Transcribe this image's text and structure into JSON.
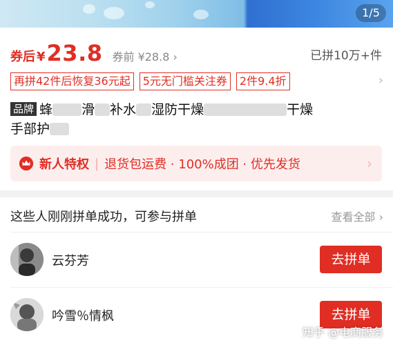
{
  "banner": {
    "pager": "1/5"
  },
  "price": {
    "label": "券后",
    "yen": "¥",
    "value": "23.8",
    "original": "券前 ¥28.8",
    "chevron": "›",
    "sold": "已拼10万+件"
  },
  "tags": [
    "再拼42件后恢复36元起",
    "5元无门槛关注券",
    "2件9.4折"
  ],
  "title": {
    "badge": "品牌",
    "part1": "蜂",
    "part2": "滑",
    "part3": "补水",
    "part4": "湿防干燥",
    "part5": "干燥",
    "line2": "手部护"
  },
  "promo": {
    "title": "新人特权",
    "separator": "|",
    "text": "退货包运费 · 100%成团 · 优先发货",
    "icon": "crown-icon"
  },
  "group": {
    "heading": "这些人刚刚拼单成功，可参与拼单",
    "view_all": "查看全部",
    "users": [
      {
        "name": "云芬芳",
        "button": "去拼单"
      },
      {
        "name": "吟雪％情枫",
        "button": "去拼单"
      }
    ]
  },
  "watermark": "知乎 @电商服务",
  "colors": {
    "accent": "#e02e24",
    "promo_bg": "#fdeeee"
  }
}
